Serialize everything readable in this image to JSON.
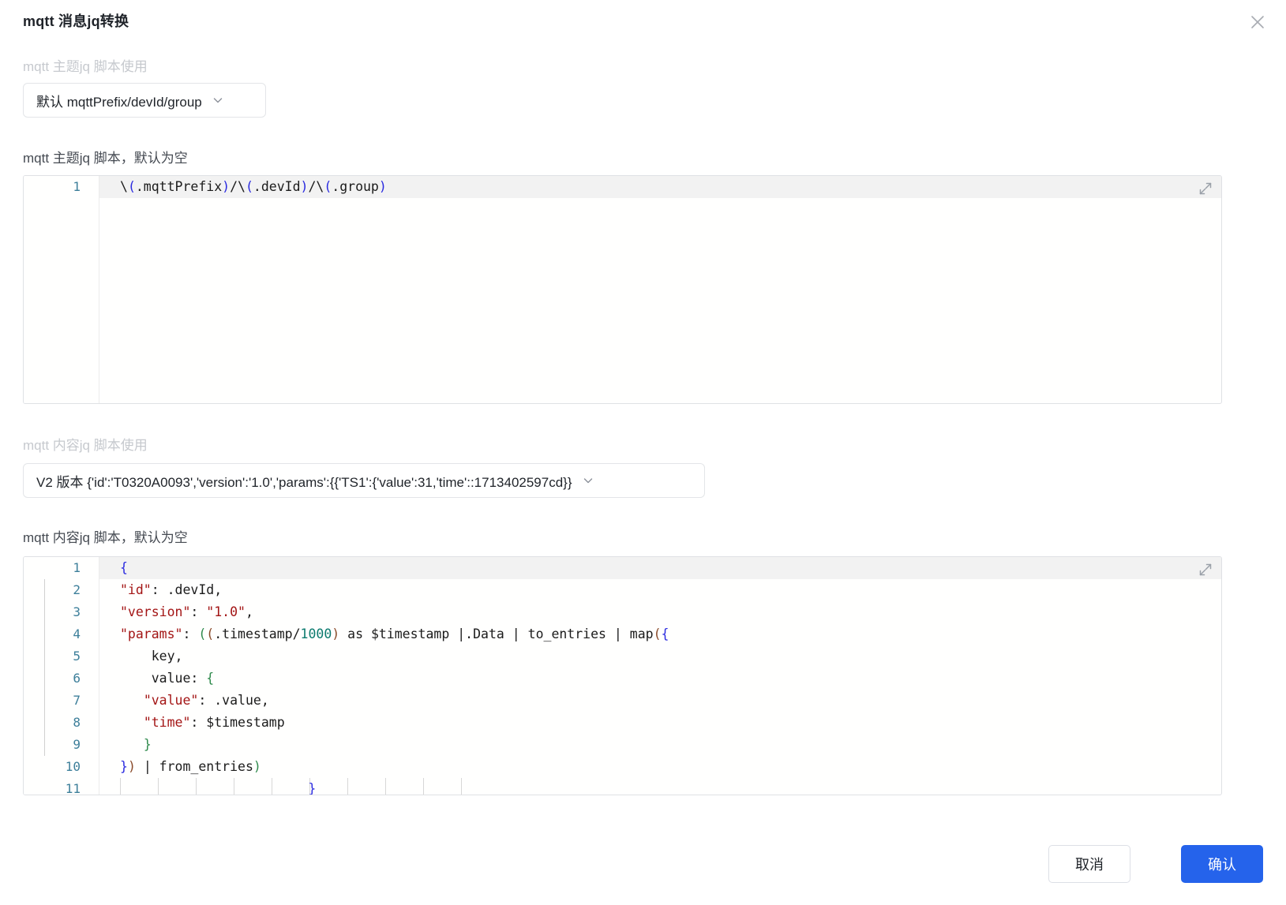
{
  "dialog": {
    "title": "mqtt 消息jq转换",
    "close_icon": "close-icon"
  },
  "topic_usage": {
    "label": "mqtt 主题jq 脚本使用",
    "selected": "默认 mqttPrefix/devId/group",
    "chevron_icon": "chevron-down-icon"
  },
  "topic_script": {
    "label": "mqtt 主题jq 脚本，默认为空",
    "expand_icon": "expand-icon",
    "lines": [
      {
        "num": "1",
        "text": "\\(.mqttPrefix)/\\(.devId)/\\(.group)"
      }
    ]
  },
  "content_usage": {
    "label": "mqtt 内容jq 脚本使用",
    "selected": "V2 版本 {'id':'T0320A0093','version':'1.0','params':{{'TS1':{'value':31,'time'::1713402597cd}}",
    "chevron_icon": "chevron-down-icon"
  },
  "content_script": {
    "label": "mqtt 内容jq 脚本，默认为空",
    "expand_icon": "expand-icon",
    "lines": [
      {
        "num": "1",
        "text": "{"
      },
      {
        "num": "2",
        "text": "\"id\": .devId,"
      },
      {
        "num": "3",
        "text": "\"version\": \"1.0\","
      },
      {
        "num": "4",
        "text": "\"params\": ((.timestamp/1000) as $timestamp |.Data | to_entries | map({"
      },
      {
        "num": "5",
        "text": "    key,"
      },
      {
        "num": "6",
        "text": "    value: {"
      },
      {
        "num": "7",
        "text": "    \"value\": .value,"
      },
      {
        "num": "8",
        "text": "    \"time\": $timestamp"
      },
      {
        "num": "9",
        "text": "    }"
      },
      {
        "num": "10",
        "text": "}) | from_entries)"
      },
      {
        "num": "11",
        "text": "                        }"
      }
    ]
  },
  "footer": {
    "cancel_label": "取消",
    "confirm_label": "确认",
    "confirm_color": "#2563eb"
  }
}
